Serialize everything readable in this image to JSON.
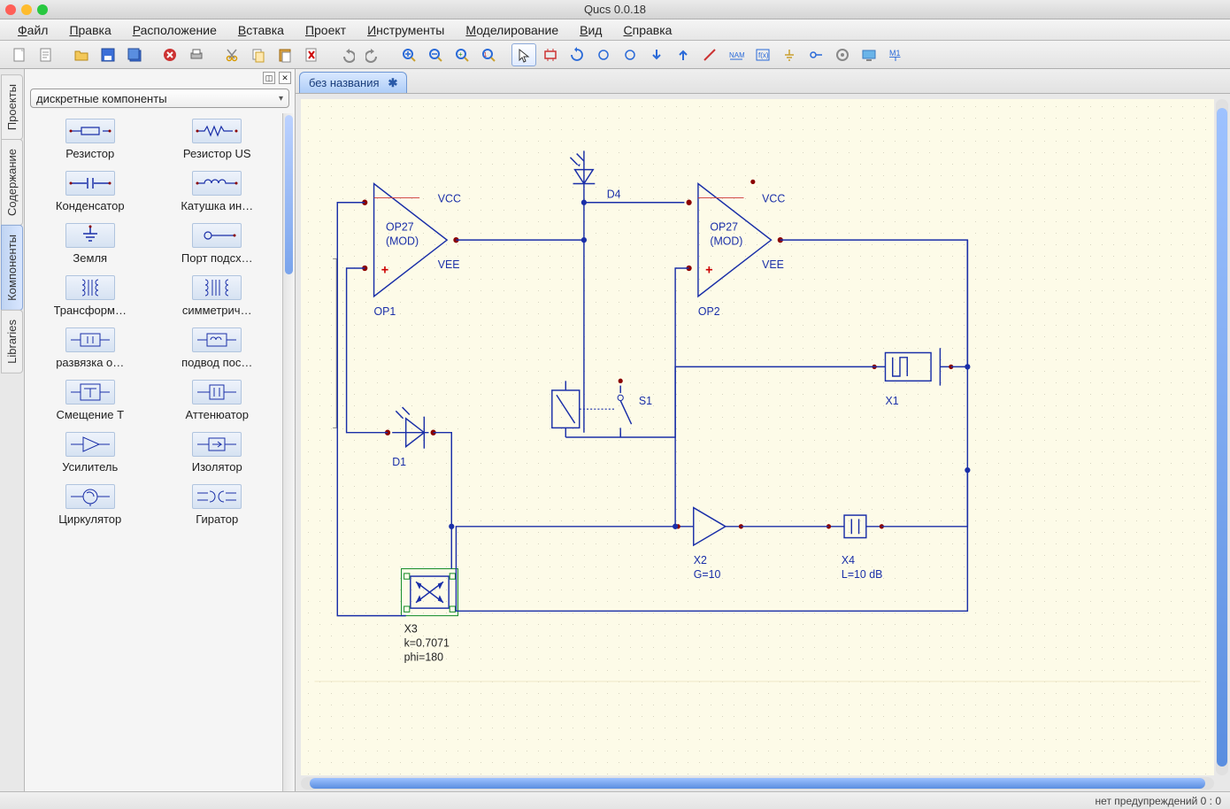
{
  "window": {
    "title": "Qucs 0.0.18"
  },
  "menu": {
    "items": [
      "Файл",
      "Правка",
      "Расположение",
      "Вставка",
      "Проект",
      "Инструменты",
      "Моделирование",
      "Вид",
      "Справка"
    ]
  },
  "toolbar": {
    "icons": [
      "new-file",
      "folder-new",
      "open",
      "save",
      "save-all",
      "close",
      "print",
      "sep",
      "cut",
      "copy",
      "paste",
      "delete",
      "sep",
      "undo",
      "redo",
      "sep",
      "zoom-in",
      "zoom-out",
      "zoom-fit",
      "zoom-100",
      "sep",
      "pointer",
      "insert-comp",
      "rotate",
      "flip-h",
      "flip-v",
      "wire",
      "label",
      "name-tag",
      "equation",
      "ground",
      "port",
      "settings",
      "display",
      "marker"
    ]
  },
  "sidetabs": {
    "items": [
      "Проекты",
      "Содержание",
      "Компоненты",
      "Libraries"
    ],
    "active": 2
  },
  "leftpanel": {
    "category": "дискретные компоненты",
    "components": [
      {
        "label": "Резистор",
        "icon": "resistor"
      },
      {
        "label": "Резистор US",
        "icon": "resistor-us"
      },
      {
        "label": "Конденсатор",
        "icon": "capacitor"
      },
      {
        "label": "Катушка ин…",
        "icon": "inductor"
      },
      {
        "label": "Земля",
        "icon": "ground"
      },
      {
        "label": "Порт подсх…",
        "icon": "subport"
      },
      {
        "label": "Трансформ…",
        "icon": "transformer"
      },
      {
        "label": "симметрич…",
        "icon": "sym-transformer"
      },
      {
        "label": "развязка о…",
        "icon": "dcblock"
      },
      {
        "label": "подвод пос…",
        "icon": "dcfeed"
      },
      {
        "label": "Смещение Т",
        "icon": "biastee"
      },
      {
        "label": "Аттенюатор",
        "icon": "attenuator"
      },
      {
        "label": "Усилитель",
        "icon": "amplifier"
      },
      {
        "label": "Изолятор",
        "icon": "isolator"
      },
      {
        "label": "Циркулятор",
        "icon": "circulator"
      },
      {
        "label": "Гиратор",
        "icon": "gyrator"
      }
    ]
  },
  "doc": {
    "tab_title": "без названия"
  },
  "schematic": {
    "labels": {
      "OP1": {
        "name": "OP1",
        "type": "OP27",
        "mod": "(MOD)",
        "vcc": "VCC",
        "vee": "VEE"
      },
      "OP2": {
        "name": "OP2",
        "type": "OP27",
        "mod": "(MOD)",
        "vcc": "VCC",
        "vee": "VEE"
      },
      "D1": "D1",
      "D4": "D4",
      "S1": "S1",
      "X1": "X1",
      "X2": {
        "name": "X2",
        "p1": "G=10"
      },
      "X3": {
        "name": "X3",
        "p1": "k=0.7071",
        "p2": "phi=180"
      },
      "X4": {
        "name": "X4",
        "p1": "L=10 dB"
      }
    }
  },
  "status": {
    "text": "нет предупреждений  0 : 0"
  }
}
